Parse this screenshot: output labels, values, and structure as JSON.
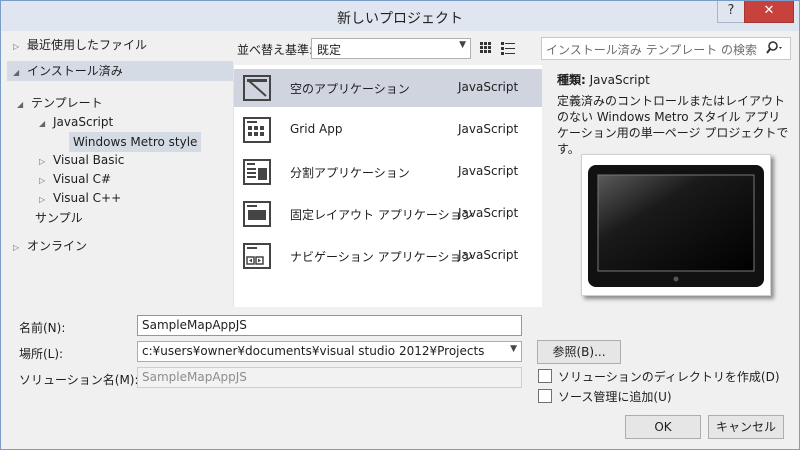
{
  "window": {
    "title": "新しいプロジェクト",
    "help_button": "?",
    "close_button": "✕"
  },
  "left_tree": {
    "recent": "最近使用したファイル",
    "installed": "インストール済み",
    "templates": "テンプレート",
    "javascript": "JavaScript",
    "windows_metro": "Windows Metro style",
    "visual_basic": "Visual Basic",
    "visual_csharp": "Visual C#",
    "visual_cpp": "Visual C++",
    "samples": "サンプル",
    "online": "オンライン"
  },
  "toolbar": {
    "sort_label": "並べ替え基準:",
    "sort_value": "既定",
    "search_placeholder": "インストール済み テンプレート の検索"
  },
  "templates": [
    {
      "name": "空のアプリケーション",
      "language": "JavaScript",
      "icon": "blank-app-icon",
      "selected": true
    },
    {
      "name": "Grid App",
      "language": "JavaScript",
      "icon": "grid-app-icon",
      "selected": false
    },
    {
      "name": "分割アプリケーション",
      "language": "JavaScript",
      "icon": "split-app-icon",
      "selected": false
    },
    {
      "name": "固定レイアウト アプリケーション",
      "language": "JavaScript",
      "icon": "fixed-layout-icon",
      "selected": false
    },
    {
      "name": "ナビゲーション アプリケーション",
      "language": "JavaScript",
      "icon": "navigation-app-icon",
      "selected": false
    }
  ],
  "details": {
    "type_label": "種類:",
    "type_value": "JavaScript",
    "description": "定義済みのコントロールまたはレイアウトのない Windows Metro スタイル アプリケーション用の単一ページ プロジェクトです。"
  },
  "form": {
    "name_label": "名前(N):",
    "name_value": "SampleMapAppJS",
    "location_label": "場所(L):",
    "location_value": "c:¥users¥owner¥documents¥visual studio 2012¥Projects",
    "solution_label": "ソリューション名(M):",
    "solution_value": "SampleMapAppJS",
    "browse_button": "参照(B)...",
    "create_dir_checkbox": "ソリューションのディレクトリを作成(D)",
    "source_control_checkbox": "ソース管理に追加(U)",
    "ok_button": "OK",
    "cancel_button": "キャンセル"
  },
  "colors": {
    "selection": "#cfd4de",
    "close_button": "#c7413d",
    "title_bar": "#dfe6ef"
  }
}
